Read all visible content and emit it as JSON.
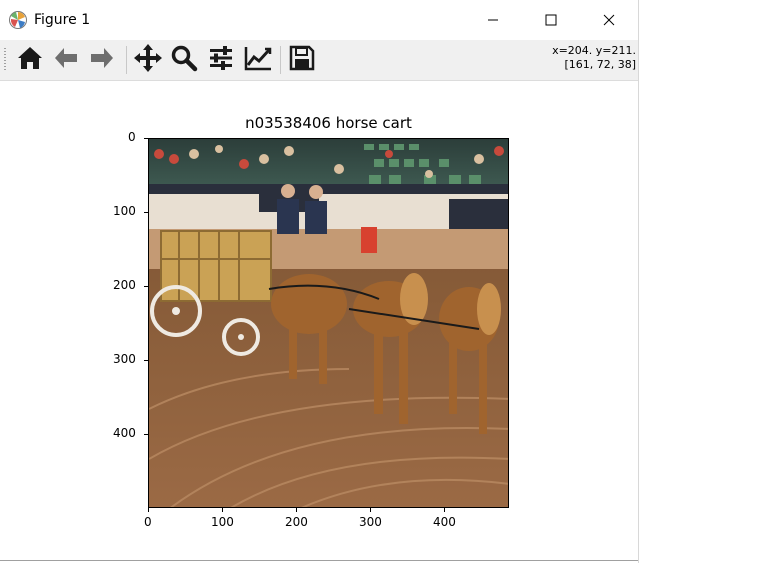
{
  "window": {
    "title": "Figure 1"
  },
  "toolbar": {
    "buttons": [
      {
        "name": "home",
        "icon": "home-icon"
      },
      {
        "name": "back",
        "icon": "arrow-left-icon"
      },
      {
        "name": "forward",
        "icon": "arrow-right-icon"
      },
      {
        "name": "pan",
        "icon": "move-icon"
      },
      {
        "name": "zoom",
        "icon": "magnifier-icon"
      },
      {
        "name": "subplots",
        "icon": "sliders-icon"
      },
      {
        "name": "edit-axes",
        "icon": "line-chart-icon"
      },
      {
        "name": "save",
        "icon": "floppy-disk-icon"
      }
    ],
    "coords_line1": "x=204. y=211.",
    "coords_line2": "[161, 72, 38]"
  },
  "figure": {
    "title": "n03538406 horse cart",
    "xticks": [
      "0",
      "100",
      "200",
      "300",
      "400"
    ],
    "yticks": [
      "0",
      "100",
      "200",
      "300",
      "400"
    ]
  },
  "colors": {
    "toolbar_bg": "#f0f0f0",
    "icon": "#1a1a1a"
  }
}
